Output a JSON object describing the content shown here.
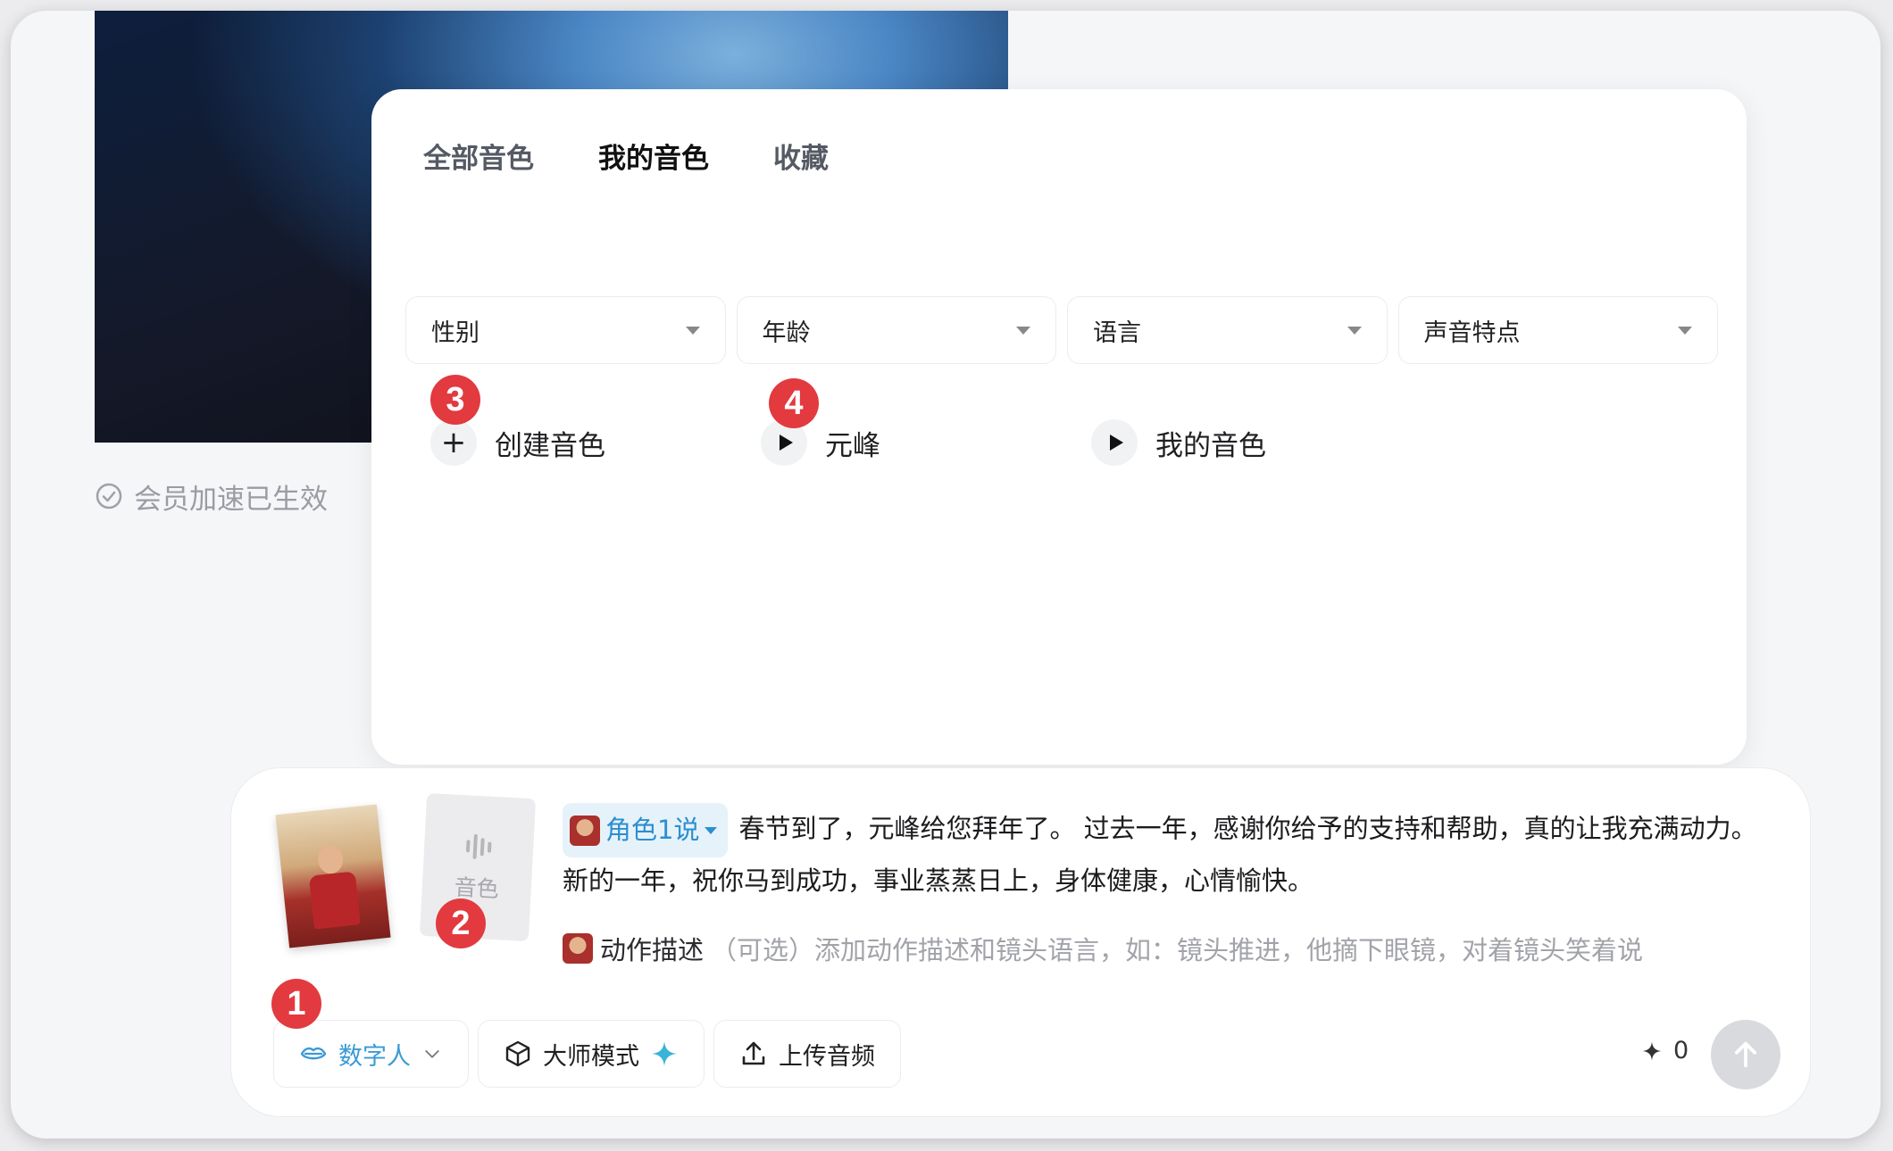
{
  "status": {
    "member_speedup": "会员加速已生效"
  },
  "voice_panel": {
    "tabs": [
      {
        "label": "全部音色"
      },
      {
        "label": "我的音色"
      },
      {
        "label": "收藏"
      }
    ],
    "active_tab": "我的音色",
    "filters": [
      {
        "label": "性别"
      },
      {
        "label": "年龄"
      },
      {
        "label": "语言"
      },
      {
        "label": "声音特点"
      }
    ],
    "voices": [
      {
        "label": "创建音色",
        "icon": "plus-icon"
      },
      {
        "label": "元峰",
        "icon": "play-icon"
      },
      {
        "label": "我的音色",
        "icon": "play-icon"
      }
    ]
  },
  "composer": {
    "voice_card_label": "音色",
    "role_chip": "角色1说",
    "prompt_text": "春节到了，元峰给您拜年了。 过去一年，感谢你给予的支持和帮助，真的让我充满动力。新的一年，祝你马到成功，事业蒸蒸日上，身体健康，心情愉快。",
    "motion_title": "动作描述",
    "motion_hint": "（可选）添加动作描述和镜头语言，如：镜头推进，他摘下眼镜，对着镜头笑着说",
    "toolbar": {
      "digital_human": "数字人",
      "master_mode": "大师模式",
      "upload_audio": "上传音频"
    },
    "credits": "0"
  },
  "badges": {
    "b1": "1",
    "b2": "2",
    "b3": "3",
    "b4": "4"
  },
  "colors": {
    "accent": "#2b8fd0",
    "badge": "#e23a3f"
  }
}
